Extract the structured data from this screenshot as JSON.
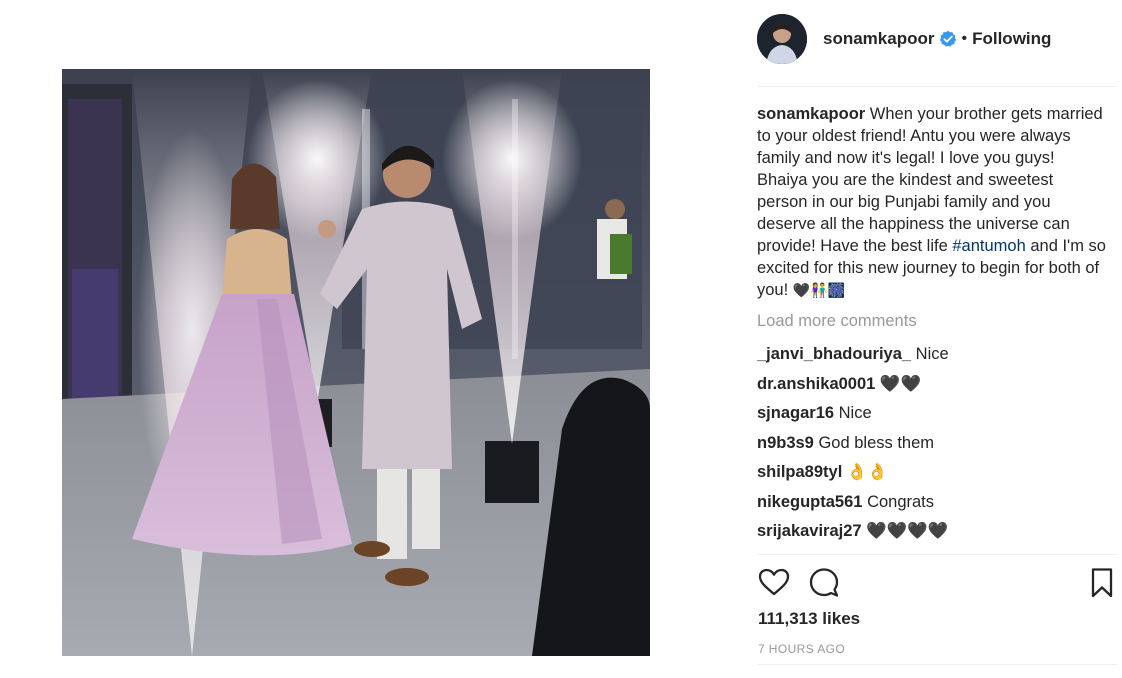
{
  "post": {
    "image_alt": "Couple walking between sparkler fountains",
    "header": {
      "username": "sonamkapoor",
      "separator": "•",
      "follow_status": "Following"
    },
    "caption": {
      "username": "sonamkapoor",
      "text_before_tag": "When your brother gets married to your oldest friend! Antu you were always family and now it's legal! I love you guys! Bhaiya you are the kindest and sweetest person in our big Punjabi family and you deserve all the happiness the universe can provide! Have the best life",
      "hashtag": "#antumoh",
      "text_after_tag": "and I'm so excited for this new journey to begin for both of you!",
      "emojis": "🖤👫🎆"
    },
    "load_more_label": "Load more comments",
    "comments": [
      {
        "username": "_janvi_bhadouriya_",
        "text": "Nice"
      },
      {
        "username": "dr.anshika0001",
        "text": "🖤🖤"
      },
      {
        "username": "sjnagar16",
        "text": "Nice"
      },
      {
        "username": "n9b3s9",
        "text": "God bless them"
      },
      {
        "username": "shilpa89tyl",
        "text": "👌👌"
      },
      {
        "username": "nikegupta561",
        "text": "Congrats"
      },
      {
        "username": "srijakaviraj27",
        "text": "🖤🖤🖤🖤"
      }
    ],
    "likes": "111,313 likes",
    "timestamp": "7 HOURS AGO",
    "icons": {
      "avatar": "profile-avatar",
      "verified": "verified-badge-icon",
      "like": "heart-outline-icon",
      "comment": "speech-bubble-icon",
      "save": "bookmark-icon"
    },
    "colors": {
      "verified": "#3897f0",
      "hashtag": "#003569",
      "muted": "#999999",
      "text": "#262626",
      "divider": "#efefef"
    }
  }
}
